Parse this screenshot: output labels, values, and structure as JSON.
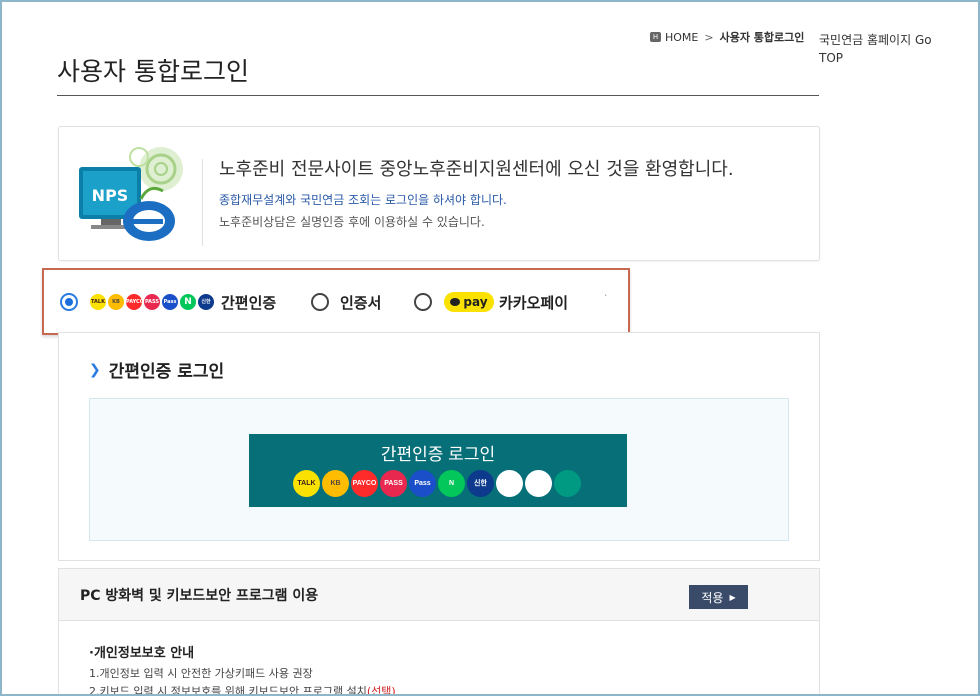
{
  "breadcrumb": {
    "home": "HOME",
    "current": "사용자 통합로그인"
  },
  "gotop": "국민연금 홈페이지 Go TOP",
  "page_title": "사용자 통합로그인",
  "welcome": {
    "title": "노후준비 전문사이트 중앙노후준비지원센터에 오신 것을 환영합니다.",
    "sub1": "종합재무설계와 국민연금 조회는 로그인을 하셔야 합니다.",
    "sub2": "노후준비상담은 실명인증 후에 이용하실 수 있습니다.",
    "logo_text": "NPS"
  },
  "auth_options": [
    {
      "label": "간편인증",
      "selected": true
    },
    {
      "label": "인증서",
      "selected": false
    },
    {
      "label": "카카오페이",
      "selected": false
    }
  ],
  "kakaopay_badge": "pay",
  "mini_icons": [
    "TALK",
    "KB",
    "PAYCO",
    "PASS",
    "Pass",
    "N",
    "신한"
  ],
  "simple_login": {
    "heading": "간편인증 로그인",
    "button_label": "간편인증 로그인",
    "icons": [
      {
        "name": "kakaotalk-icon",
        "text": "TALK",
        "bg": "#fae100",
        "fg": "#3a1d1d"
      },
      {
        "name": "kb-icon",
        "text": "KB",
        "bg": "#ffbc00",
        "fg": "#544a40"
      },
      {
        "name": "payco-icon",
        "text": "PAYCO",
        "bg": "#ff2a2a",
        "fg": "#ffffff"
      },
      {
        "name": "pass-icon",
        "text": "PASS",
        "bg": "#e8284f",
        "fg": "#ffffff"
      },
      {
        "name": "samsung-pass-icon",
        "text": "Pass",
        "bg": "#1a4fc9",
        "fg": "#ffffff"
      },
      {
        "name": "naver-icon",
        "text": "N",
        "bg": "#03c75a",
        "fg": "#ffffff"
      },
      {
        "name": "shinhan-icon",
        "text": "신한",
        "bg": "#0d3a8c",
        "fg": "#ffffff"
      },
      {
        "name": "toss-icon",
        "text": "",
        "bg": "#ffffff",
        "fg": "#1b64da"
      },
      {
        "name": "banksalad-icon",
        "text": "",
        "bg": "#ffffff",
        "fg": "#19b34a"
      },
      {
        "name": "hana-icon",
        "text": "",
        "bg": "#009a82",
        "fg": "#ffffff"
      }
    ]
  },
  "pc_security": {
    "title": "PC 방화벽 및 키보드보안 프로그램 이용",
    "apply_label": "적용",
    "privacy_title": "·개인정보보호 안내",
    "line1": "1.개인정보 입력 시 안전한 가상키패드 사용 권장",
    "line2": "2.키보드 입력 시 정보보호를 위해 키보드보안 프로그램 설치",
    "line2_req": "(선택)"
  }
}
